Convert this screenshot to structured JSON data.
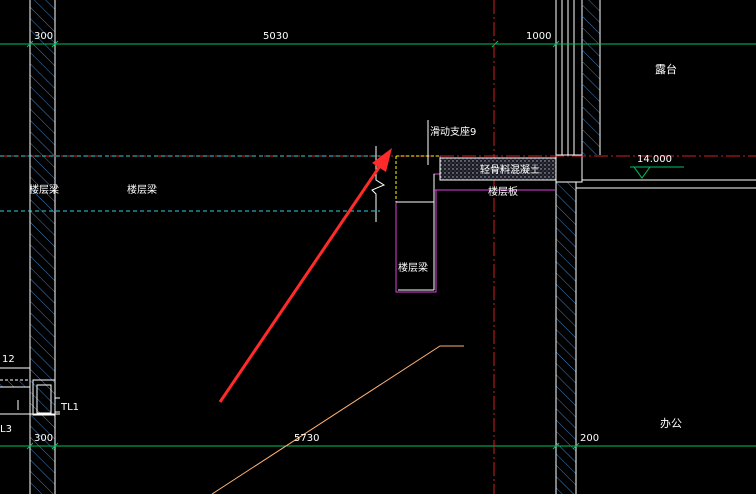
{
  "colors": {
    "background": "#000000",
    "wall_hatch": "#3f7fbf",
    "wall_line": "#ffffff",
    "dim_line": "#00c060",
    "axis_line": "#d02020",
    "beam_dash": "#30d0e0",
    "slab_line": "#e040e0",
    "support_yellow": "#ffff00",
    "concrete_fill": "#9090a0",
    "arrow": "#ff2a2a",
    "stair_line": "#ffb070",
    "text": "#ffffff"
  },
  "dimensions": {
    "top_left": "300",
    "top_mid": "5030",
    "top_right": "1000",
    "bottom_left": "300",
    "bottom_mid": "5730",
    "bottom_right": "200"
  },
  "labels": {
    "balcony": "露台",
    "office": "办公",
    "sliding_support": "滑动支座",
    "sliding_support_no": "9",
    "lightweight_concrete": "轻骨料混凝土",
    "floor_slab": "楼层板",
    "floor_beam_left": "楼层梁",
    "floor_beam_mid": "楼层梁",
    "floor_beam_drop": "楼层梁",
    "elevation": "14.000",
    "left_edge_12": "12",
    "left_edge_l3": "L3",
    "tl1": "TL1"
  }
}
